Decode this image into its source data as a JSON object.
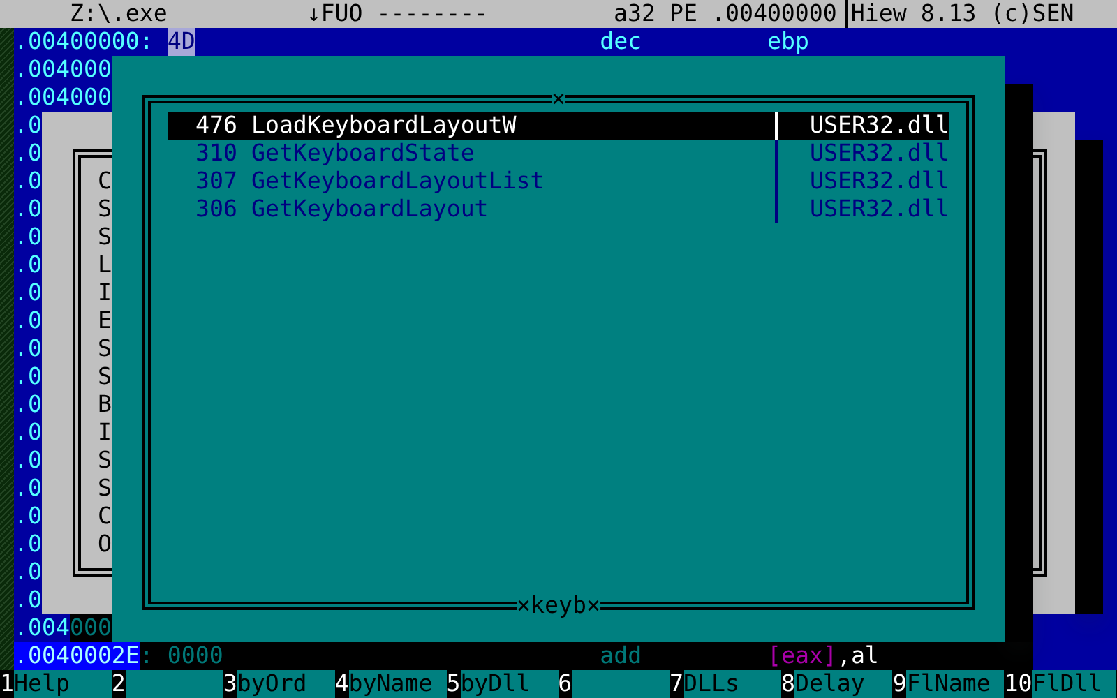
{
  "title_bar": {
    "file": "Z:\\.exe",
    "mode": "↓FUO --------",
    "info": "a32 PE .00400000",
    "version": "Hiew 8.13 (c)SEN"
  },
  "code_lines": [
    {
      "kind": "instruction",
      "address": ".00400000:",
      "bytes": "4D",
      "mnemonic": "dec",
      "operand": "ebp"
    },
    {
      "kind": "covered",
      "address": ".004000"
    },
    {
      "kind": "covered",
      "address": ".004000"
    },
    {
      "kind": "covered",
      "address": ".0"
    },
    {
      "kind": "covered",
      "address": ".0"
    },
    {
      "kind": "covered",
      "address": ".0"
    },
    {
      "kind": "covered",
      "address": ".0"
    },
    {
      "kind": "covered",
      "address": ".0"
    },
    {
      "kind": "covered",
      "address": ".0"
    },
    {
      "kind": "covered",
      "address": ".0"
    },
    {
      "kind": "covered",
      "address": ".0"
    },
    {
      "kind": "covered",
      "address": ".0"
    },
    {
      "kind": "covered",
      "address": ".0"
    },
    {
      "kind": "covered",
      "address": ".0"
    },
    {
      "kind": "covered",
      "address": ".0"
    },
    {
      "kind": "covered",
      "address": ".0"
    },
    {
      "kind": "covered",
      "address": ".0"
    },
    {
      "kind": "covered",
      "address": ".0"
    },
    {
      "kind": "covered",
      "address": ".0"
    },
    {
      "kind": "covered",
      "address": ".0"
    },
    {
      "kind": "covered",
      "address": ".0"
    },
    {
      "kind": "shadowed",
      "address": ".004",
      "tail": "000"
    }
  ],
  "status_line": {
    "address": ".0040002E",
    "offset": ": 0000",
    "mnemonic": "add",
    "operand_memory": "[eax]",
    "operand_rest": ",al"
  },
  "background_dialog": {
    "items": [
      "C",
      "S",
      "S",
      "L",
      "I",
      "E",
      "S",
      "S",
      "B",
      "I",
      "S",
      "S",
      "C",
      "O"
    ]
  },
  "import_dialog": {
    "top_mark": "×",
    "title": "×keyb×",
    "rows": [
      {
        "ordinal": "476",
        "name": "LoadKeyboardLayoutW",
        "dll": "USER32.dll",
        "selected": true
      },
      {
        "ordinal": "310",
        "name": "GetKeyboardState",
        "dll": "USER32.dll",
        "selected": false
      },
      {
        "ordinal": "307",
        "name": "GetKeyboardLayoutList",
        "dll": "USER32.dll",
        "selected": false
      },
      {
        "ordinal": "306",
        "name": "GetKeyboardLayout",
        "dll": "USER32.dll",
        "selected": false
      }
    ]
  },
  "function_keys": [
    {
      "key": "1",
      "label": "Help"
    },
    {
      "key": "2"
    },
    {
      "key": "3",
      "label": "byOrd"
    },
    {
      "key": "4",
      "label": "byName"
    },
    {
      "key": "5",
      "label": "byDll"
    },
    {
      "key": "6"
    },
    {
      "key": "7",
      "label": "DLLs"
    },
    {
      "key": "8",
      "label": "Delay"
    },
    {
      "key": "9",
      "label": "FlName"
    },
    {
      "key": "10",
      "label": "FlDll"
    }
  ]
}
